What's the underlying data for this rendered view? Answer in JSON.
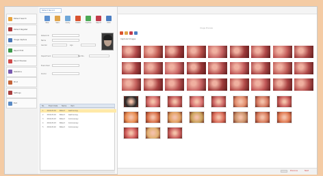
{
  "app": {
    "tab_label": "Patient Record"
  },
  "nav": {
    "items": [
      {
        "label": "Patient Search",
        "icon": "home-icon",
        "color": "#e8a23b"
      },
      {
        "label": "Patient Register",
        "icon": "user-icon",
        "color": "#b03a3a"
      },
      {
        "label": "Image Capture",
        "icon": "camera-icon",
        "color": "#4a78b8"
      },
      {
        "label": "Report Edit",
        "icon": "document-icon",
        "color": "#3c9a4a"
      },
      {
        "label": "Report Review",
        "icon": "pen-icon",
        "color": "#d04a4a"
      },
      {
        "label": "Statistics",
        "icon": "chart-icon",
        "color": "#7a5ab0"
      },
      {
        "label": "Print",
        "icon": "printer-icon",
        "color": "#c4643a"
      },
      {
        "label": "Settings",
        "icon": "gear-icon",
        "color": "#a84040"
      },
      {
        "label": "Exit",
        "icon": "exit-icon",
        "color": "#5a8ac4"
      }
    ]
  },
  "toolbar": {
    "buttons": [
      {
        "label": "New",
        "color": "#5b8fd0"
      },
      {
        "label": "Save",
        "color": "#e0a44a"
      },
      {
        "label": "Query",
        "color": "#6fa7d8"
      },
      {
        "label": "Delete",
        "color": "#d9532f"
      },
      {
        "label": "Capture",
        "color": "#4caa55"
      },
      {
        "label": "Report",
        "color": "#c23b4b"
      },
      {
        "label": "Print",
        "color": "#4b7ec2"
      }
    ]
  },
  "form": {
    "fields": [
      {
        "label": "Patient ID"
      },
      {
        "label": "Name"
      },
      {
        "label": "Gender"
      },
      {
        "label": "Age"
      },
      {
        "label": "Department"
      },
      {
        "label": "Bed No."
      },
      {
        "label": "Exam Item"
      },
      {
        "label": "Doctor"
      }
    ]
  },
  "records": {
    "columns": [
      "No.",
      "Exam Date",
      "Name",
      "Item"
    ],
    "rows": [
      {
        "no": "1",
        "date": "2016-05-04",
        "name": "Patient",
        "item": "Gastroscopy",
        "selected": true
      },
      {
        "no": "2",
        "date": "2016-05-04",
        "name": "Patient",
        "item": "Gastroscopy",
        "selected": false
      },
      {
        "no": "3",
        "date": "2016-05-03",
        "name": "Patient",
        "item": "Colonoscopy",
        "selected": false
      },
      {
        "no": "4",
        "date": "2016-05-03",
        "name": "Patient",
        "item": "Colonoscopy",
        "selected": false
      },
      {
        "no": "5",
        "date": "2016-05-02",
        "name": "Patient",
        "item": "Colonoscopy",
        "selected": false
      }
    ]
  },
  "images": {
    "folder_label": "Captured Images",
    "hint": "Image Preview",
    "mini_tool_colors": [
      "#d9532f",
      "#e0a44a",
      "#c23b4b",
      "#4b7ec2"
    ],
    "large_colors": [
      "#b24a4a",
      "#c05a52",
      "#a43c3c",
      "#b8504a",
      "#c46060",
      "#9e3a3a",
      "#b04848",
      "#c25a58",
      "#a84444",
      "#a64040",
      "#b85452",
      "#c86464",
      "#9a3636",
      "#b24c4c",
      "#c05858",
      "#aa4646",
      "#be5a56",
      "#b04a4a",
      "#c25e5a",
      "#a84242",
      "#b65050",
      "#c66262",
      "#a03c3c",
      "#b44c4a",
      "#c05656",
      "#aa4444",
      "#b85250"
    ],
    "small_colors": [
      "#2a2a2a",
      "#d46a6a",
      "#c45a5a",
      "#d87070",
      "#c86060",
      "#e08a6a",
      "#d47860",
      "#c85a5a",
      "#e88c50",
      "#d87048",
      "#e0a060",
      "#c9a25a",
      "#d86a58",
      "#c89068",
      "#d67a5a",
      "#e07a52",
      "#d05a5a",
      "#e0b070",
      "#c85c5c"
    ]
  },
  "footer": {
    "link_left": "Previous",
    "link_right": "Next"
  }
}
